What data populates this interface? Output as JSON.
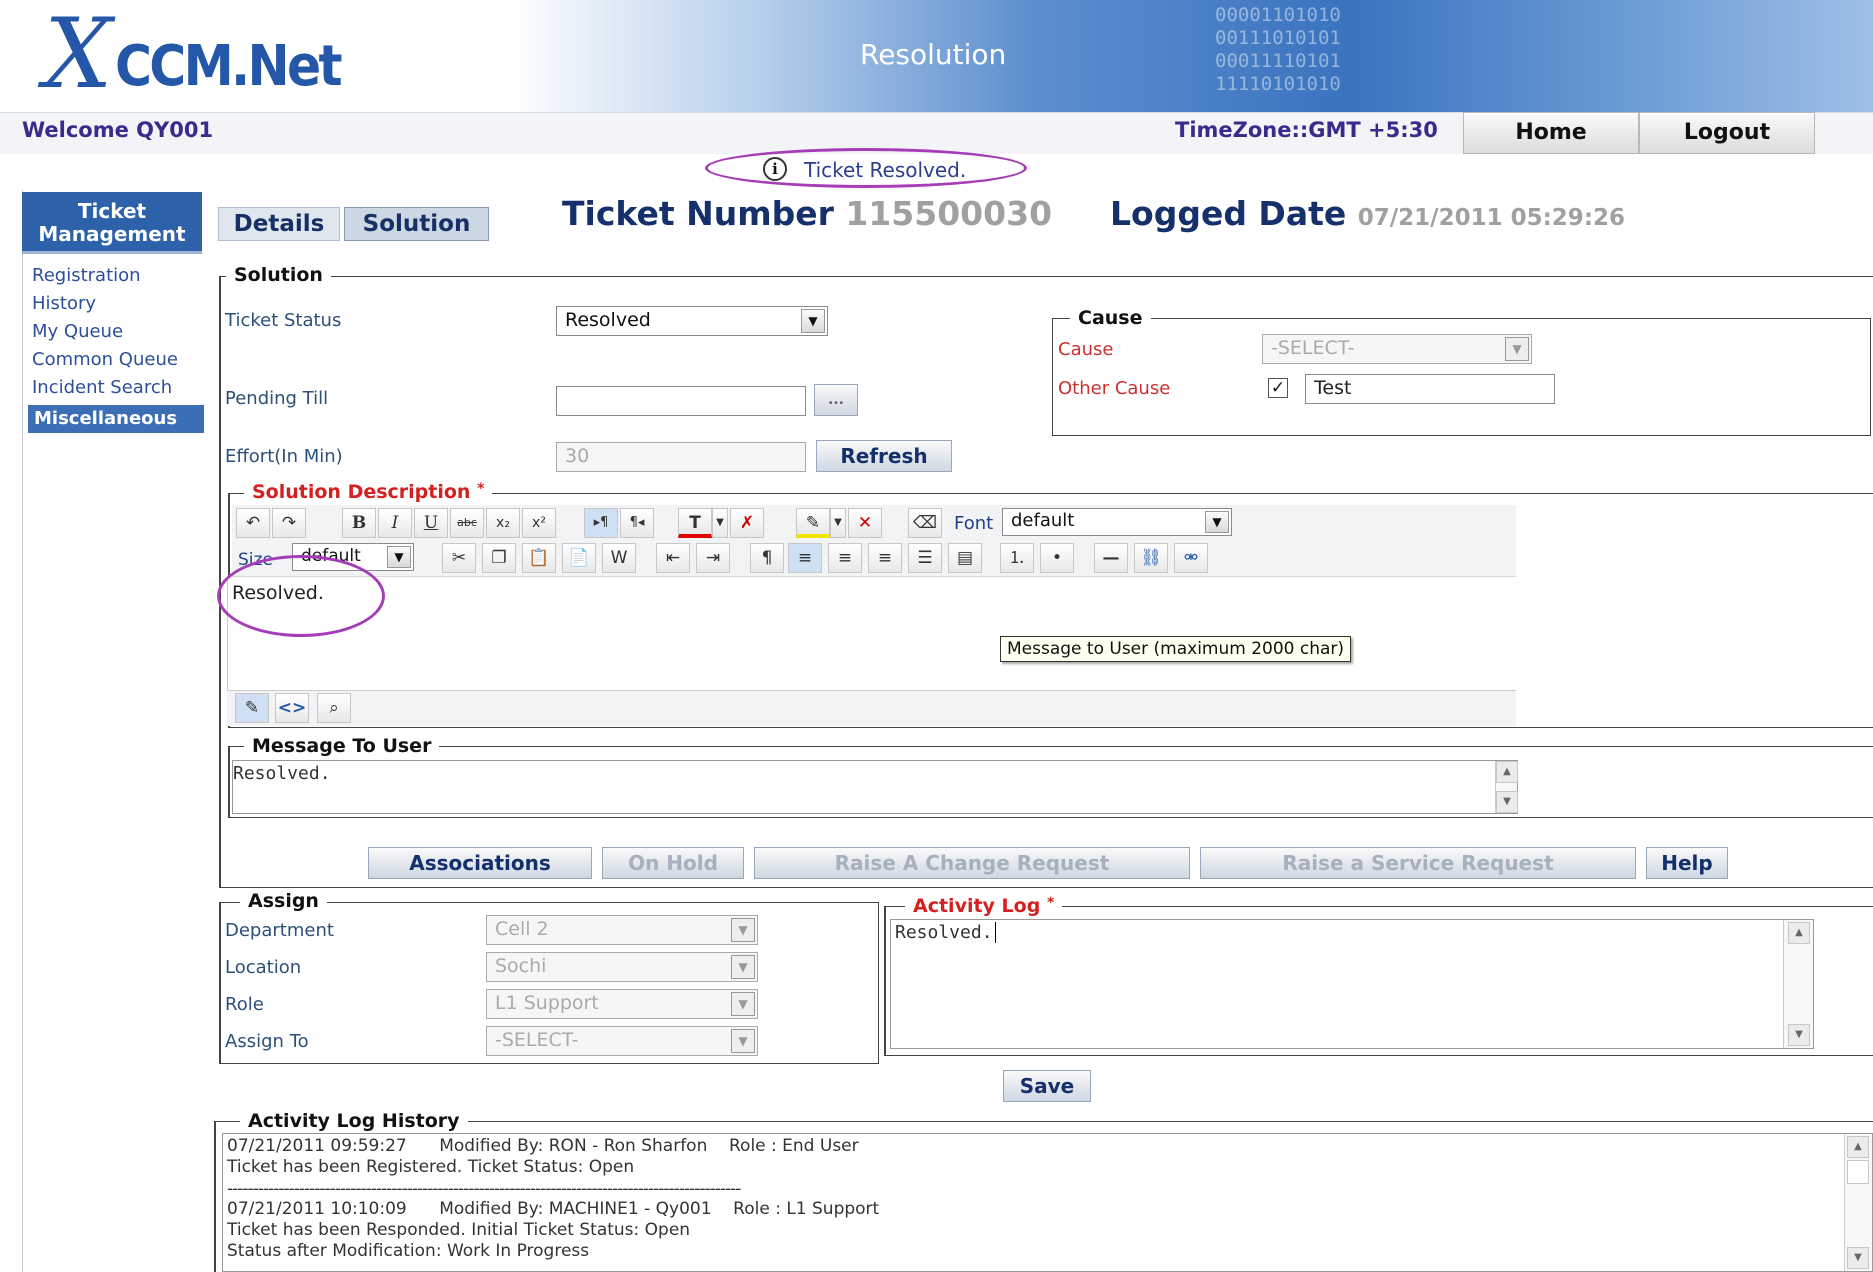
{
  "header": {
    "logo_text": "CCM.Net",
    "page_title": "Resolution",
    "binary_text": "00001101010\n00111010101\n00011110101\n11110101010"
  },
  "topbar": {
    "welcome": "Welcome QY001",
    "timezone": "TimeZone::GMT +5:30",
    "home_label": "Home",
    "logout_label": "Logout"
  },
  "sidebar": {
    "section_title": "Ticket Management",
    "items": [
      "Registration",
      "History",
      "My Queue",
      "Common Queue",
      "Incident Search"
    ],
    "active_item": "Miscellaneous"
  },
  "tabs": {
    "details": "Details",
    "solution": "Solution"
  },
  "notification": {
    "icon": "info-icon",
    "text": "Ticket Resolved."
  },
  "ticket": {
    "number_label": "Ticket Number",
    "number": "115500030",
    "logged_label": "Logged Date",
    "logged_date": "07/21/2011 05:29:26"
  },
  "solution": {
    "legend": "Solution",
    "status_label": "Ticket Status",
    "status_value": "Resolved",
    "pending_label": "Pending Till",
    "pending_value": "",
    "pending_btn": "...",
    "effort_label": "Effort(In Min)",
    "effort_value": "30",
    "refresh_label": "Refresh"
  },
  "cause": {
    "legend": "Cause",
    "cause_label": "Cause",
    "cause_value": "-SELECT-",
    "other_label": "Other Cause",
    "other_checked": true,
    "other_value": "Test"
  },
  "description": {
    "legend": "Solution Description",
    "required_mark": "*",
    "font_label": "Font",
    "font_value": "default",
    "size_label": "Size",
    "size_value": "default",
    "content": "Resolved.",
    "tooltip": "Message to User (maximum 2000 char)"
  },
  "message": {
    "legend": "Message To User",
    "content": "Resolved."
  },
  "actions": {
    "associations": "Associations",
    "on_hold": "On Hold",
    "change_request": "Raise A Change Request",
    "service_request": "Raise a Service Request",
    "help": "Help"
  },
  "assign": {
    "legend": "Assign",
    "department_label": "Department",
    "department_value": "Cell 2",
    "location_label": "Location",
    "location_value": "Sochi",
    "role_label": "Role",
    "role_value": "L1 Support",
    "assign_to_label": "Assign To",
    "assign_to_value": "-SELECT-"
  },
  "activity_log": {
    "legend": "Activity Log",
    "required_mark": "*",
    "content": "Resolved."
  },
  "save_label": "Save",
  "history": {
    "legend": "Activity Log History",
    "entries": [
      {
        "timestamp": "07/21/2011 09:59:27",
        "modified_by": "Modified By: RON - Ron Sharfon",
        "role": "Role : End User",
        "line2": "Ticket has been Registered. Ticket Status: Open"
      },
      {
        "timestamp": "07/21/2011 10:10:09",
        "modified_by": "Modified By: MACHINE1 - Qy001",
        "role": "Role : L1 Support",
        "line2": "Ticket has been Responded. Initial Ticket Status: Open",
        "line3": "Status after Modification: Work In Progress"
      }
    ],
    "separator": "----------------------------------------------------------------------------------------------------"
  },
  "colors": {
    "brand_blue": "#2457a8",
    "heading_navy": "#15306b",
    "required_red": "#d42020",
    "annotation_purple": "#a73cb9",
    "menu_active": "#3b6eb5"
  }
}
